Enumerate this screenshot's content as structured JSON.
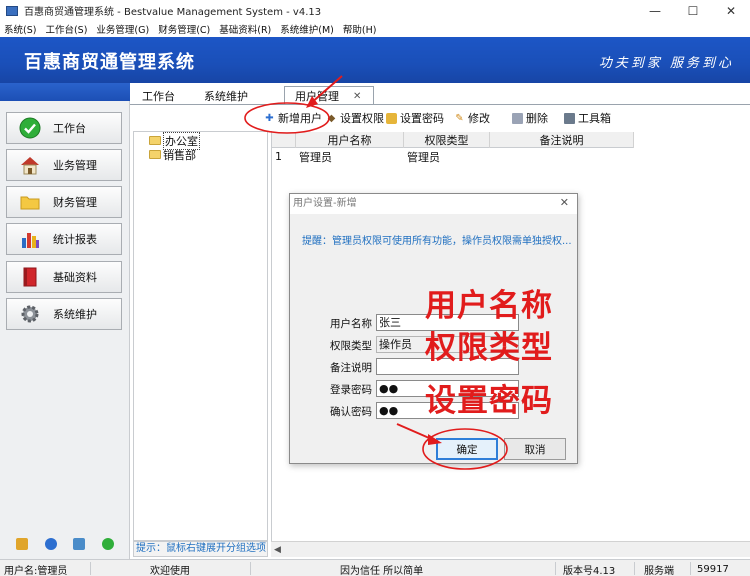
{
  "window": {
    "title": "百惠商贸通管理系统 - Bestvalue Management System - v4.13",
    "minimize_glyph": "—",
    "maximize_glyph": "☐",
    "close_glyph": "✕"
  },
  "menubar": {
    "items": [
      "系统(S)",
      "工作台(S)",
      "业务管理(G)",
      "财务管理(C)",
      "基础资料(R)",
      "系统维护(M)",
      "帮助(H)"
    ]
  },
  "banner": {
    "title": "百惠商贸通管理系统",
    "slogan": "功夫到家 服务到心"
  },
  "sidebar": {
    "items": [
      {
        "label": "工作台",
        "icon": "check-circle-icon"
      },
      {
        "label": "业务管理",
        "icon": "house-icon"
      },
      {
        "label": "财务管理",
        "icon": "folder-icon"
      },
      {
        "label": "统计报表",
        "icon": "bar-chart-icon"
      },
      {
        "label": "基础资料",
        "icon": "book-icon"
      },
      {
        "label": "系统维护",
        "icon": "gear-icon"
      }
    ],
    "bottom_icons": [
      "lock-icon",
      "info-icon",
      "search-icon",
      "refresh-icon"
    ]
  },
  "tabs": {
    "items": [
      {
        "label": "工作台"
      },
      {
        "label": "系统维护"
      },
      {
        "label": "用户管理",
        "active": true
      }
    ],
    "close_glyph": "✕"
  },
  "toolbar": {
    "add_user": "新增用户",
    "set_permission": "设置权限",
    "set_password": "设置密码",
    "edit": "修改",
    "delete": "删除",
    "toolbox": "工具箱"
  },
  "tree": {
    "items": [
      "办公室",
      "销售部"
    ],
    "hint": "提示：鼠标右键展开分组选项"
  },
  "grid": {
    "columns": [
      "用户名称",
      "权限类型",
      "备注说明"
    ],
    "rows": [
      {
        "index": "1",
        "name": "管理员",
        "role": "管理员",
        "note": ""
      }
    ]
  },
  "dialog": {
    "title": "用户设置-新增",
    "hint": "提醒：管理员权限可使用所有功能，操作员权限需单独授权...",
    "fields": {
      "username_label": "用户名称",
      "username_value": "张三",
      "role_label": "权限类型",
      "role_value": "操作员",
      "note_label": "备注说明",
      "note_value": "",
      "password_label": "登录密码",
      "password_value": "●●",
      "confirm_label": "确认密码",
      "confirm_value": "●●"
    },
    "ok_button": "确定",
    "cancel_button": "取消"
  },
  "annotations": {
    "line1": "用户名称",
    "line2": "权限类型",
    "line3": "设置密码",
    "color": "#e11c1c"
  },
  "statusbar": {
    "user": "用户名:管理员",
    "welcome": "欢迎使用",
    "motto": "因为信任 所以简单",
    "version": "版本号4.13",
    "server": "服务端",
    "port": "59917"
  }
}
